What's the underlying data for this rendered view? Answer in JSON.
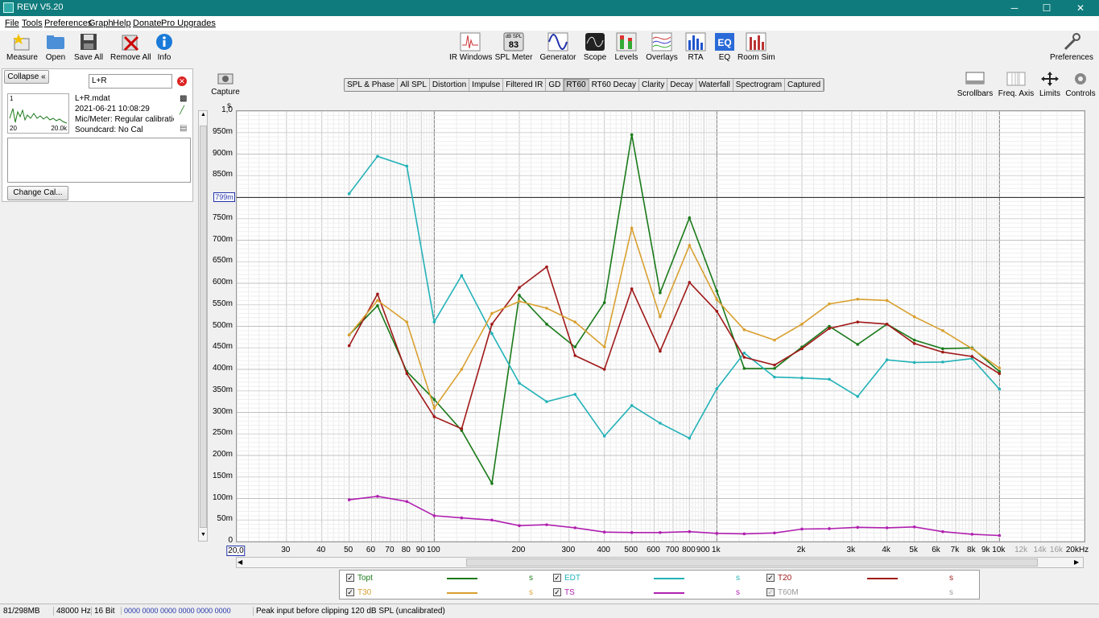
{
  "window": {
    "title": "REW V5.20",
    "min": "─",
    "max": "☐",
    "close": "✕"
  },
  "menu": [
    "File",
    "Tools",
    "Preferences",
    "Graph",
    "Help",
    "Donate",
    "Pro Upgrades"
  ],
  "toolbar_left": [
    {
      "label": "Measure",
      "icon": "measure-icon"
    },
    {
      "label": "Open",
      "icon": "folder-icon"
    },
    {
      "label": "Save All",
      "icon": "floppy-icon"
    },
    {
      "label": "Remove All",
      "icon": "remove-icon"
    },
    {
      "label": "Info",
      "icon": "info-icon"
    }
  ],
  "toolbar_center": [
    {
      "label": "IR Windows",
      "icon": "ir-windows-icon"
    },
    {
      "label": "SPL Meter",
      "icon": "spl-meter-icon",
      "badge_top": "dB SPL",
      "badge_val": "83"
    },
    {
      "label": "Generator",
      "icon": "generator-icon"
    },
    {
      "label": "Scope",
      "icon": "scope-icon"
    },
    {
      "label": "Levels",
      "icon": "levels-icon"
    },
    {
      "label": "Overlays",
      "icon": "overlays-icon"
    },
    {
      "label": "RTA",
      "icon": "rta-icon"
    },
    {
      "label": "EQ",
      "icon": "eq-icon"
    },
    {
      "label": "Room Sim",
      "icon": "room-sim-icon"
    }
  ],
  "toolbar_right": {
    "label": "Preferences",
    "icon": "wrench-icon"
  },
  "panel": {
    "collapse": "Collapse",
    "collapse_icon": "«",
    "filter": "L+R",
    "file": "L+R.mdat",
    "date": "2021-06-21 10:08:29",
    "mic": "Mic/Meter: Regular calibratior",
    "soundcard": "Soundcard: No Cal",
    "thumb_min": "20",
    "thumb_max": "20.0k",
    "thumb_level": "1",
    "change_cal": "Change Cal..."
  },
  "capture": "Capture",
  "tabs": [
    "SPL & Phase",
    "All SPL",
    "Distortion",
    "Impulse",
    "Filtered IR",
    "GD",
    "RT60",
    "RT60 Decay",
    "Clarity",
    "Decay",
    "Waterfall",
    "Spectrogram",
    "Captured"
  ],
  "selected_tab": "RT60",
  "right_tools": [
    "Scrollbars",
    "Freq. Axis",
    "Limits",
    "Controls"
  ],
  "chart_data": {
    "type": "line",
    "yunit": "s",
    "ylim": [
      0,
      1.0
    ],
    "xlim": [
      20,
      20000
    ],
    "xscale": "log",
    "cursor_label": "799m",
    "cursor_value": 0.799,
    "yticks": [
      {
        "v": 1.0,
        "t": "1,0"
      },
      {
        "v": 0.95,
        "t": "950m"
      },
      {
        "v": 0.9,
        "t": "900m"
      },
      {
        "v": 0.85,
        "t": "850m"
      },
      {
        "v": 0.75,
        "t": "750m"
      },
      {
        "v": 0.7,
        "t": "700m"
      },
      {
        "v": 0.65,
        "t": "650m"
      },
      {
        "v": 0.6,
        "t": "600m"
      },
      {
        "v": 0.55,
        "t": "550m"
      },
      {
        "v": 0.5,
        "t": "500m"
      },
      {
        "v": 0.45,
        "t": "450m"
      },
      {
        "v": 0.4,
        "t": "400m"
      },
      {
        "v": 0.35,
        "t": "350m"
      },
      {
        "v": 0.3,
        "t": "300m"
      },
      {
        "v": 0.25,
        "t": "250m"
      },
      {
        "v": 0.2,
        "t": "200m"
      },
      {
        "v": 0.15,
        "t": "150m"
      },
      {
        "v": 0.1,
        "t": "100m"
      },
      {
        "v": 0.05,
        "t": "50m"
      },
      {
        "v": 0,
        "t": "0"
      }
    ],
    "xticks": [
      {
        "v": 20,
        "t": "20,0"
      },
      {
        "v": 30,
        "t": "30"
      },
      {
        "v": 40,
        "t": "40"
      },
      {
        "v": 50,
        "t": "50"
      },
      {
        "v": 60,
        "t": "60"
      },
      {
        "v": 70,
        "t": "70"
      },
      {
        "v": 80,
        "t": "80"
      },
      {
        "v": 90,
        "t": "90"
      },
      {
        "v": 100,
        "t": "100"
      },
      {
        "v": 200,
        "t": "200"
      },
      {
        "v": 300,
        "t": "300"
      },
      {
        "v": 400,
        "t": "400"
      },
      {
        "v": 500,
        "t": "500"
      },
      {
        "v": 600,
        "t": "600"
      },
      {
        "v": 700,
        "t": "700"
      },
      {
        "v": 800,
        "t": "800"
      },
      {
        "v": 900,
        "t": "900"
      },
      {
        "v": 1000,
        "t": "1k"
      },
      {
        "v": 2000,
        "t": "2k"
      },
      {
        "v": 3000,
        "t": "3k"
      },
      {
        "v": 4000,
        "t": "4k"
      },
      {
        "v": 5000,
        "t": "5k"
      },
      {
        "v": 6000,
        "t": "6k"
      },
      {
        "v": 7000,
        "t": "7k"
      },
      {
        "v": 8000,
        "t": "8k"
      },
      {
        "v": 9000,
        "t": "9k"
      },
      {
        "v": 10000,
        "t": "10k"
      },
      {
        "v": 12000,
        "t": "12k",
        "grey": true
      },
      {
        "v": 14000,
        "t": "14k",
        "grey": true
      },
      {
        "v": 16000,
        "t": "16k",
        "grey": true
      },
      {
        "v": 20000,
        "t": "20kHz"
      }
    ],
    "x": [
      50,
      63,
      80,
      100,
      125,
      160,
      200,
      250,
      315,
      400,
      500,
      630,
      800,
      1000,
      1250,
      1600,
      2000,
      2500,
      3150,
      4000,
      5000,
      6300,
      8000,
      10000
    ],
    "series": [
      {
        "name": "Topt",
        "color": "#1a7a1a",
        "checked": true,
        "values": [
          0.48,
          0.548,
          0.395,
          0.33,
          0.258,
          0.135,
          0.572,
          0.505,
          0.452,
          0.555,
          0.945,
          0.578,
          0.752,
          0.582,
          0.402,
          0.402,
          0.452,
          0.5,
          0.458,
          0.505,
          0.468,
          0.448,
          0.45,
          0.395
        ]
      },
      {
        "name": "EDT",
        "color": "#22b2b8",
        "checked": true,
        "values": [
          0.808,
          0.895,
          0.872,
          0.51,
          0.618,
          0.483,
          0.368,
          0.325,
          0.342,
          0.245,
          0.316,
          0.275,
          0.24,
          0.355,
          0.438,
          0.382,
          0.38,
          0.377,
          0.337,
          0.422,
          0.416,
          0.417,
          0.425,
          0.354
        ]
      },
      {
        "name": "T20",
        "color": "#a01818",
        "checked": true,
        "values": [
          0.455,
          0.575,
          0.39,
          0.29,
          0.262,
          0.505,
          0.59,
          0.638,
          0.432,
          0.4,
          0.587,
          0.442,
          0.602,
          0.535,
          0.428,
          0.41,
          0.448,
          0.495,
          0.51,
          0.505,
          0.46,
          0.44,
          0.43,
          0.39
        ]
      },
      {
        "name": "T30",
        "color": "#d9a030",
        "checked": true,
        "values": [
          0.48,
          0.56,
          0.51,
          0.31,
          0.4,
          0.53,
          0.558,
          0.542,
          0.51,
          0.452,
          0.728,
          0.522,
          0.688,
          0.562,
          0.492,
          0.468,
          0.505,
          0.552,
          0.563,
          0.56,
          0.522,
          0.49,
          0.448,
          0.403
        ]
      },
      {
        "name": "TS",
        "color": "#b020b0",
        "checked": true,
        "values": [
          0.097,
          0.105,
          0.093,
          0.06,
          0.055,
          0.05,
          0.037,
          0.039,
          0.032,
          0.022,
          0.021,
          0.021,
          0.023,
          0.019,
          0.018,
          0.02,
          0.029,
          0.03,
          0.033,
          0.032,
          0.034,
          0.023,
          0.017,
          0.014
        ]
      },
      {
        "name": "T60M",
        "color": "#999999",
        "checked": false,
        "values": []
      }
    ]
  },
  "legend_unit": "s",
  "status": {
    "mem": "81/298MB",
    "rate": "48000 Hz",
    "bits": "16 Bit",
    "meters": "0000 0000   0000 0000   0000 0000",
    "peak": "Peak input before clipping 120 dB SPL (uncalibrated)"
  }
}
